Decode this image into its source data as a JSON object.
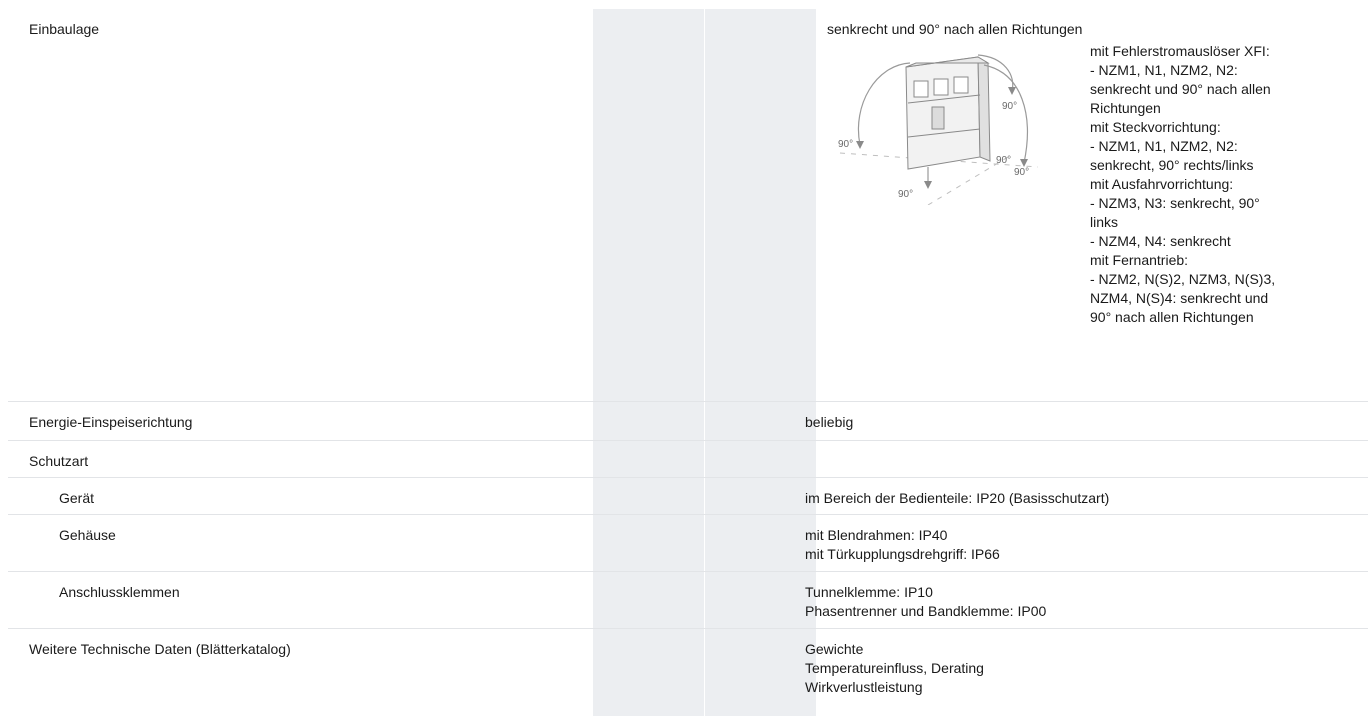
{
  "rows": [
    {
      "label": "Einbaulage",
      "caption": "senkrecht und 90° nach allen Richtungen",
      "diagram_labels": [
        "90°",
        "90°",
        "90°",
        "90°",
        "90°"
      ],
      "note_lines": [
        "mit Fehlerstromauslöser XFI:",
        "- NZM1, N1, NZM2, N2:",
        "senkrecht und 90° nach allen",
        "Richtungen",
        "mit Steckvorrichtung:",
        "- NZM1, N1, NZM2, N2:",
        "senkrecht, 90° rechts/links",
        "mit Ausfahrvorrichtung:",
        "- NZM3, N3: senkrecht, 90°",
        "links",
        "- NZM4, N4: senkrecht",
        "mit Fernantrieb:",
        "- NZM2, N(S)2, NZM3, N(S)3,",
        "NZM4, N(S)4: senkrecht und",
        "90° nach allen Richtungen"
      ]
    },
    {
      "label": "Energie-Einspeiserichtung",
      "value_lines": [
        "beliebig"
      ]
    },
    {
      "label": "Schutzart",
      "value_lines": []
    },
    {
      "label": "Gerät",
      "value_lines": [
        "im Bereich der Bedienteile: IP20 (Basisschutzart)"
      ]
    },
    {
      "label": "Gehäuse",
      "value_lines": [
        "mit Blendrahmen: IP40",
        "mit Türkupplungsdrehgriff: IP66"
      ]
    },
    {
      "label": "Anschlussklemmen",
      "value_lines": [
        "Tunnelklemme: IP10",
        "Phasentrenner und Bandklemme: IP00"
      ]
    },
    {
      "label": "Weitere Technische Daten (Blätterkatalog)",
      "value_lines": [
        "Gewichte",
        "Temperatureinfluss, Derating",
        "Wirkverlustleistung"
      ]
    }
  ]
}
